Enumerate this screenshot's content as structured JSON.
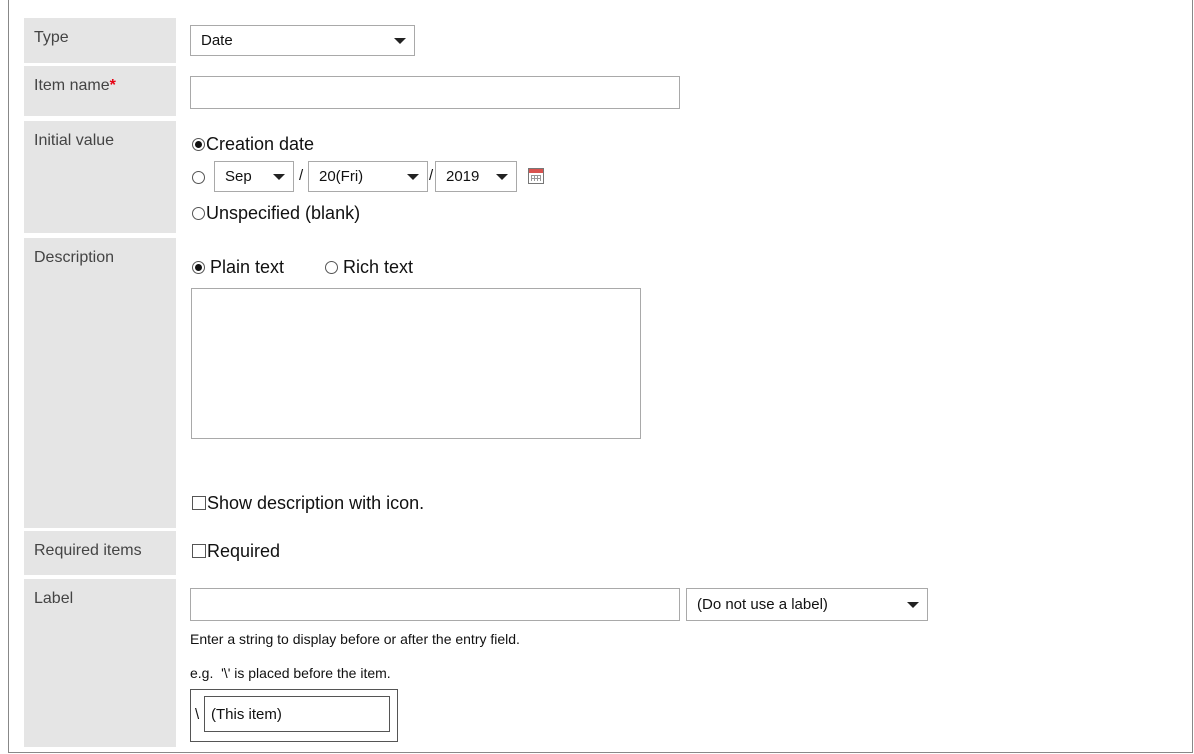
{
  "form": {
    "type": {
      "label": "Type",
      "value": "Date"
    },
    "item_name": {
      "label": "Item name",
      "required_mark": "*",
      "value": ""
    },
    "initial_value": {
      "label": "Initial value",
      "option_creation": "Creation date",
      "month": "Sep",
      "separator": "/",
      "day": "20(Fri)",
      "year": "2019",
      "option_unspecified": "Unspecified (blank)",
      "selected": "creation"
    },
    "description": {
      "label": "Description",
      "option_plain": "Plain text",
      "option_rich": "Rich text",
      "selected": "plain",
      "value": "",
      "show_icon_label": "Show description with icon."
    },
    "required_items": {
      "label": "Required items",
      "checkbox_label": "Required"
    },
    "label_field": {
      "label": "Label",
      "value": "",
      "position_select": "(Do not use a label)",
      "help_1": "Enter a string to display before or after the entry field.",
      "help_2": "e.g.  '\\' is placed before the item.",
      "example_prefix": "\\",
      "example_item": "(This item)"
    }
  },
  "icons": {
    "calendar": "calendar-icon",
    "dropdown": "chevron-down-icon"
  },
  "colors": {
    "label_bg": "#e5e5e5",
    "required": "#e60012",
    "border": "#a9a9a9"
  }
}
